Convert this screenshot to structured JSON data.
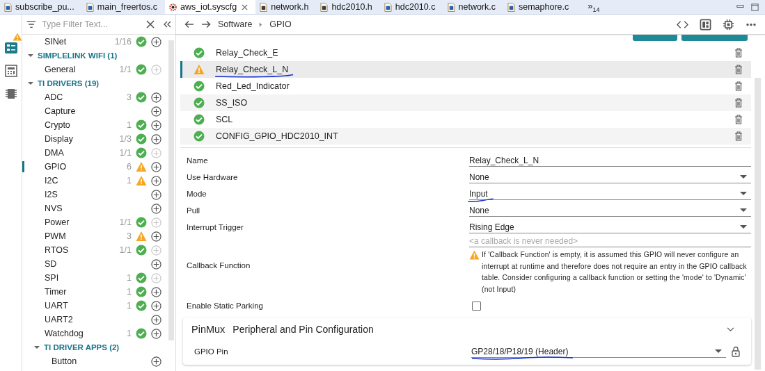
{
  "tabs": [
    {
      "label": "subscribe_pu...",
      "kind": "c",
      "selected": false
    },
    {
      "label": "main_freertos.c",
      "kind": "c",
      "selected": false
    },
    {
      "label": "aws_iot.syscfg",
      "kind": "syscfg",
      "selected": true
    },
    {
      "label": "network.h",
      "kind": "h",
      "selected": false
    },
    {
      "label": "hdc2010.h",
      "kind": "h",
      "selected": false
    },
    {
      "label": "hdc2010.c",
      "kind": "c",
      "selected": false
    },
    {
      "label": "network.c",
      "kind": "c",
      "selected": false
    },
    {
      "label": "semaphore.c",
      "kind": "c",
      "selected": false
    }
  ],
  "overflow": {
    "glyph": "»",
    "count": "14"
  },
  "sidebar": {
    "filter": {
      "placeholder": "Type Filter Text..."
    },
    "items": [
      {
        "kind": "item",
        "label": "SINet",
        "count": "1/16",
        "configured": true,
        "warning": false,
        "add_enabled": true,
        "selected": false
      },
      {
        "kind": "group",
        "label": "SIMPLELINK WIFI (1)",
        "expanded": true
      },
      {
        "kind": "item",
        "label": "General",
        "count": "1/1",
        "configured": true,
        "warning": false,
        "add_enabled": false,
        "selected": false
      },
      {
        "kind": "group",
        "label": "TI DRIVERS (19)",
        "expanded": true
      },
      {
        "kind": "item",
        "label": "ADC",
        "count": "3",
        "configured": true,
        "warning": false,
        "add_enabled": true,
        "selected": false
      },
      {
        "kind": "item",
        "label": "Capture",
        "configured": false,
        "add_enabled": true,
        "selected": false
      },
      {
        "kind": "item",
        "label": "Crypto",
        "count": "1",
        "configured": true,
        "warning": false,
        "add_enabled": true,
        "selected": false
      },
      {
        "kind": "item",
        "label": "Display",
        "count": "1/3",
        "configured": true,
        "warning": false,
        "add_enabled": true,
        "selected": false
      },
      {
        "kind": "item",
        "label": "DMA",
        "count": "1/1",
        "configured": true,
        "warning": false,
        "add_enabled": false,
        "selected": false
      },
      {
        "kind": "item",
        "label": "GPIO",
        "count": "6",
        "configured": true,
        "warning": true,
        "add_enabled": true,
        "selected": true
      },
      {
        "kind": "item",
        "label": "I2C",
        "count": "1",
        "configured": true,
        "warning": true,
        "add_enabled": true,
        "selected": false
      },
      {
        "kind": "item",
        "label": "I2S",
        "configured": false,
        "add_enabled": true,
        "selected": false
      },
      {
        "kind": "item",
        "label": "NVS",
        "configured": false,
        "add_enabled": true,
        "selected": false
      },
      {
        "kind": "item",
        "label": "Power",
        "count": "1/1",
        "configured": true,
        "warning": false,
        "add_enabled": false,
        "selected": false
      },
      {
        "kind": "item",
        "label": "PWM",
        "count": "3",
        "configured": true,
        "warning": true,
        "add_enabled": true,
        "selected": false
      },
      {
        "kind": "item",
        "label": "RTOS",
        "count": "1/1",
        "configured": true,
        "warning": false,
        "add_enabled": false,
        "selected": false
      },
      {
        "kind": "item",
        "label": "SD",
        "configured": false,
        "add_enabled": true,
        "selected": false
      },
      {
        "kind": "item",
        "label": "SPI",
        "count": "1",
        "configured": true,
        "warning": false,
        "add_enabled": false,
        "selected": false
      },
      {
        "kind": "item",
        "label": "Timer",
        "count": "1",
        "configured": true,
        "warning": false,
        "add_enabled": true,
        "selected": false
      },
      {
        "kind": "item",
        "label": "UART",
        "count": "1",
        "configured": true,
        "warning": false,
        "add_enabled": true,
        "selected": false
      },
      {
        "kind": "item",
        "label": "UART2",
        "configured": false,
        "add_enabled": true,
        "selected": false
      },
      {
        "kind": "item",
        "label": "Watchdog",
        "count": "1",
        "configured": true,
        "warning": false,
        "add_enabled": true,
        "selected": false
      },
      {
        "kind": "subgroup",
        "label": "TI DRIVER APPS (2)",
        "expanded": true
      },
      {
        "kind": "subitem",
        "label": "Button",
        "configured": false,
        "add_enabled": true,
        "selected": false
      }
    ]
  },
  "breadcrumb": [
    "Software",
    "GPIO"
  ],
  "instances": [
    {
      "name": "Relay_Check_E",
      "warning": false,
      "selected": false,
      "underlined": false
    },
    {
      "name": "Relay_Check_L_N",
      "warning": true,
      "selected": true,
      "underlined": true
    },
    {
      "name": "Red_Led_Indicator",
      "warning": false,
      "selected": false,
      "underlined": false
    },
    {
      "name": "SS_ISO",
      "warning": false,
      "selected": false,
      "underlined": false
    },
    {
      "name": "SCL",
      "warning": false,
      "selected": false,
      "underlined": false
    },
    {
      "name": "CONFIG_GPIO_HDC2010_INT",
      "warning": false,
      "selected": false,
      "underlined": false
    }
  ],
  "fields": [
    {
      "kind": "text",
      "label": "Name",
      "value": "Relay_Check_L_N",
      "underlined": false
    },
    {
      "kind": "select",
      "label": "Use Hardware",
      "value": "None",
      "underlined": false
    },
    {
      "kind": "select",
      "label": "Mode",
      "value": "Input",
      "underlined": true
    },
    {
      "kind": "select",
      "label": "Pull",
      "value": "None",
      "underlined": false
    },
    {
      "kind": "select",
      "label": "Interrupt Trigger",
      "value": "Rising Edge",
      "underlined": false
    },
    {
      "kind": "callback",
      "label": "Callback Function",
      "placeholder": "<a callback is never needed>",
      "warning": "If 'Callback Function' is empty, it is assumed this GPIO will never configure an interrupt at runtime and therefore does not require an entry in the GPIO callback table. Consider configuring a callback function or setting the 'mode' to 'Dynamic' (not Input)"
    },
    {
      "kind": "checkbox",
      "label": "Enable Static Parking",
      "checked": false
    }
  ],
  "pinmux": {
    "title": "PinMux",
    "subtitle": "Peripheral and Pin Configuration",
    "expanded": true,
    "pin_label": "GPIO Pin",
    "pin_value": "GP28/18/P18/19 (Header)",
    "locked": true,
    "underlined": true
  }
}
